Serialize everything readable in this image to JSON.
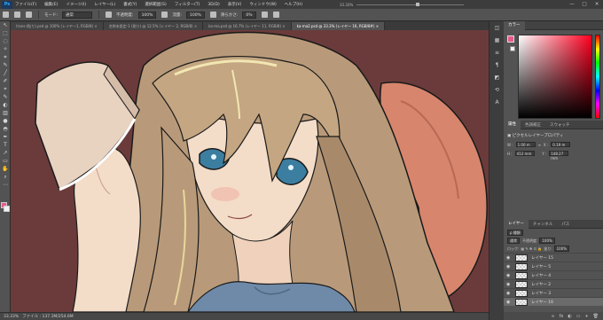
{
  "app": {
    "logo": "Ps"
  },
  "menu": [
    "ファイル(F)",
    "編集(E)",
    "イメージ(I)",
    "レイヤー(L)",
    "書式(Y)",
    "選択範囲(S)",
    "フィルター(T)",
    "3D(D)",
    "表示(V)",
    "ウィンドウ(W)",
    "ヘルプ(H)"
  ],
  "window_controls": [
    "—",
    "□",
    "✕"
  ],
  "zoom_slider": {
    "value": "33.33%",
    "fraction": 0.55
  },
  "options": {
    "mode_label": "モード:",
    "mode_value": "通常",
    "opacity_label": "不透明度:",
    "opacity_value": "100%",
    "flow_label": "流量:",
    "flow_value": "100%",
    "smoothing_label": "滑らかさ:",
    "smoothing_value": "0%"
  },
  "tabs": [
    {
      "label": "trans-(貼り).psd @ 100% (レイヤー1, RGB/8) ×",
      "active": false
    },
    {
      "label": "名称未設定-1 (貼り) @ 12.5% (レイヤー 2, RGB/8) ×",
      "active": false
    },
    {
      "label": "ka-ma.psd @ 16.7% (レイヤー 11, RGB/8) ×",
      "active": false
    },
    {
      "label": "ka-ma2.psd @ 33.3% (レイヤー 16, RGB/8#) ×",
      "active": true
    }
  ],
  "tools": [
    "↖",
    "⬚",
    "◌",
    "✧",
    "⌗",
    "✎",
    "╱",
    "✐",
    "⌖",
    "✎",
    "◐",
    "▥",
    "●",
    "◓",
    "✒",
    "T",
    "↗",
    "▭",
    "✋",
    "⌕",
    "⋯"
  ],
  "status": {
    "zoom": "33.33%",
    "doc": "ファイル : 137.1M/254.6M"
  },
  "color_panel": {
    "tab": "カラー",
    "fg": "#e85b8a",
    "bg": "#f1f1f1"
  },
  "properties": {
    "tabs": [
      "属性",
      "色調補正",
      "スウォッチ"
    ],
    "title": "ピクセルレイヤープロパティ",
    "w_label": "W :",
    "w_value": "1.00 m",
    "x_label": "X :",
    "x_value": "0.19 m",
    "h_label": "H :",
    "h_value": "412 mm",
    "y_label": "Y :",
    "y_value": "148.27 mm"
  },
  "layers_panel": {
    "tabs": [
      "レイヤー",
      "チャンネル",
      "パス"
    ],
    "kind": "ρ 種類",
    "blend": "通常",
    "opacity_label": "不透明度:",
    "opacity_value": "100%",
    "lock_label": "ロック:",
    "fill_label": "塗り:",
    "fill_value": "100%",
    "layers": [
      {
        "name": "レイヤー 15",
        "active": false
      },
      {
        "name": "レイヤー 5",
        "active": false
      },
      {
        "name": "レイヤー 4",
        "active": false
      },
      {
        "name": "レイヤー 2",
        "active": false
      },
      {
        "name": "レイヤー 3",
        "active": false
      },
      {
        "name": "レイヤー 16",
        "active": true
      }
    ],
    "footer": [
      "∞",
      "fx",
      "◐",
      "▭",
      "+",
      "🗑"
    ]
  },
  "icon_strip": [
    "◫",
    "▦",
    "≡",
    "¶",
    "◩",
    "⟲",
    "A"
  ],
  "colors": {
    "canvas_bg": "#6b3b3b",
    "hair": "#b89a7a",
    "skin": "#f3dcc8",
    "eye": "#3c7ea0",
    "shirt": "#6f8aa8",
    "book": "#e8d2c0",
    "pillow": "#d7856d"
  }
}
